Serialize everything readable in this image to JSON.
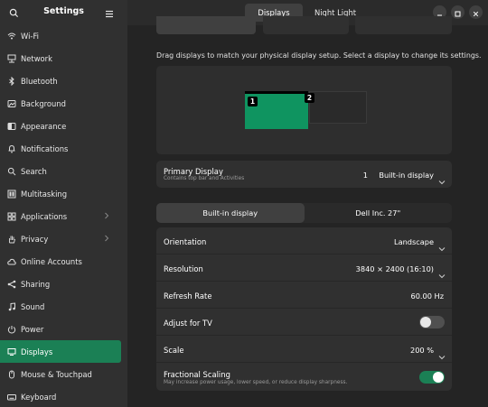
{
  "sidebar": {
    "title": "Settings",
    "items": [
      {
        "label": "Wi-Fi",
        "icon": "wifi-icon"
      },
      {
        "label": "Network",
        "icon": "network-icon"
      },
      {
        "label": "Bluetooth",
        "icon": "bluetooth-icon"
      },
      {
        "label": "Background",
        "icon": "background-icon"
      },
      {
        "label": "Appearance",
        "icon": "appearance-icon"
      },
      {
        "label": "Notifications",
        "icon": "bell-icon"
      },
      {
        "label": "Search",
        "icon": "search-icon"
      },
      {
        "label": "Multitasking",
        "icon": "multitasking-icon"
      },
      {
        "label": "Applications",
        "icon": "applications-icon"
      },
      {
        "label": "Privacy",
        "icon": "privacy-hand-icon"
      },
      {
        "label": "Online Accounts",
        "icon": "cloud-icon"
      },
      {
        "label": "Sharing",
        "icon": "share-icon"
      },
      {
        "label": "Sound",
        "icon": "music-note-icon"
      },
      {
        "label": "Power",
        "icon": "power-icon"
      },
      {
        "label": "Displays",
        "icon": "display-icon"
      },
      {
        "label": "Mouse & Touchpad",
        "icon": "mouse-icon"
      },
      {
        "label": "Keyboard",
        "icon": "keyboard-icon"
      }
    ]
  },
  "header": {
    "tabs": [
      "Displays",
      "Night Light"
    ]
  },
  "arrangement": {
    "instruction": "Drag displays to match your physical display setup. Select a display to change its settings.",
    "monitor1_label": "1",
    "monitor2_label": "2"
  },
  "primary": {
    "label": "Primary Display",
    "sublabel": "Contains top bar and Activities",
    "value_num": "1",
    "value": "Built-in display"
  },
  "display_tabs": [
    "Built-in display",
    "Dell Inc. 27\""
  ],
  "settings": {
    "orientation": {
      "label": "Orientation",
      "value": "Landscape"
    },
    "resolution": {
      "label": "Resolution",
      "value": "3840 × 2400 (16:10)"
    },
    "refresh": {
      "label": "Refresh Rate",
      "value": "60.00 Hz"
    },
    "adjust_tv": {
      "label": "Adjust for TV",
      "enabled": false
    },
    "scale": {
      "label": "Scale",
      "value": "200 %"
    },
    "fractional": {
      "label": "Fractional Scaling",
      "sublabel": "May increase power usage, lower speed, or reduce display sharpness.",
      "enabled": true
    }
  },
  "colors": {
    "accent": "#1b8055",
    "monitor_selected": "#0f9460"
  }
}
